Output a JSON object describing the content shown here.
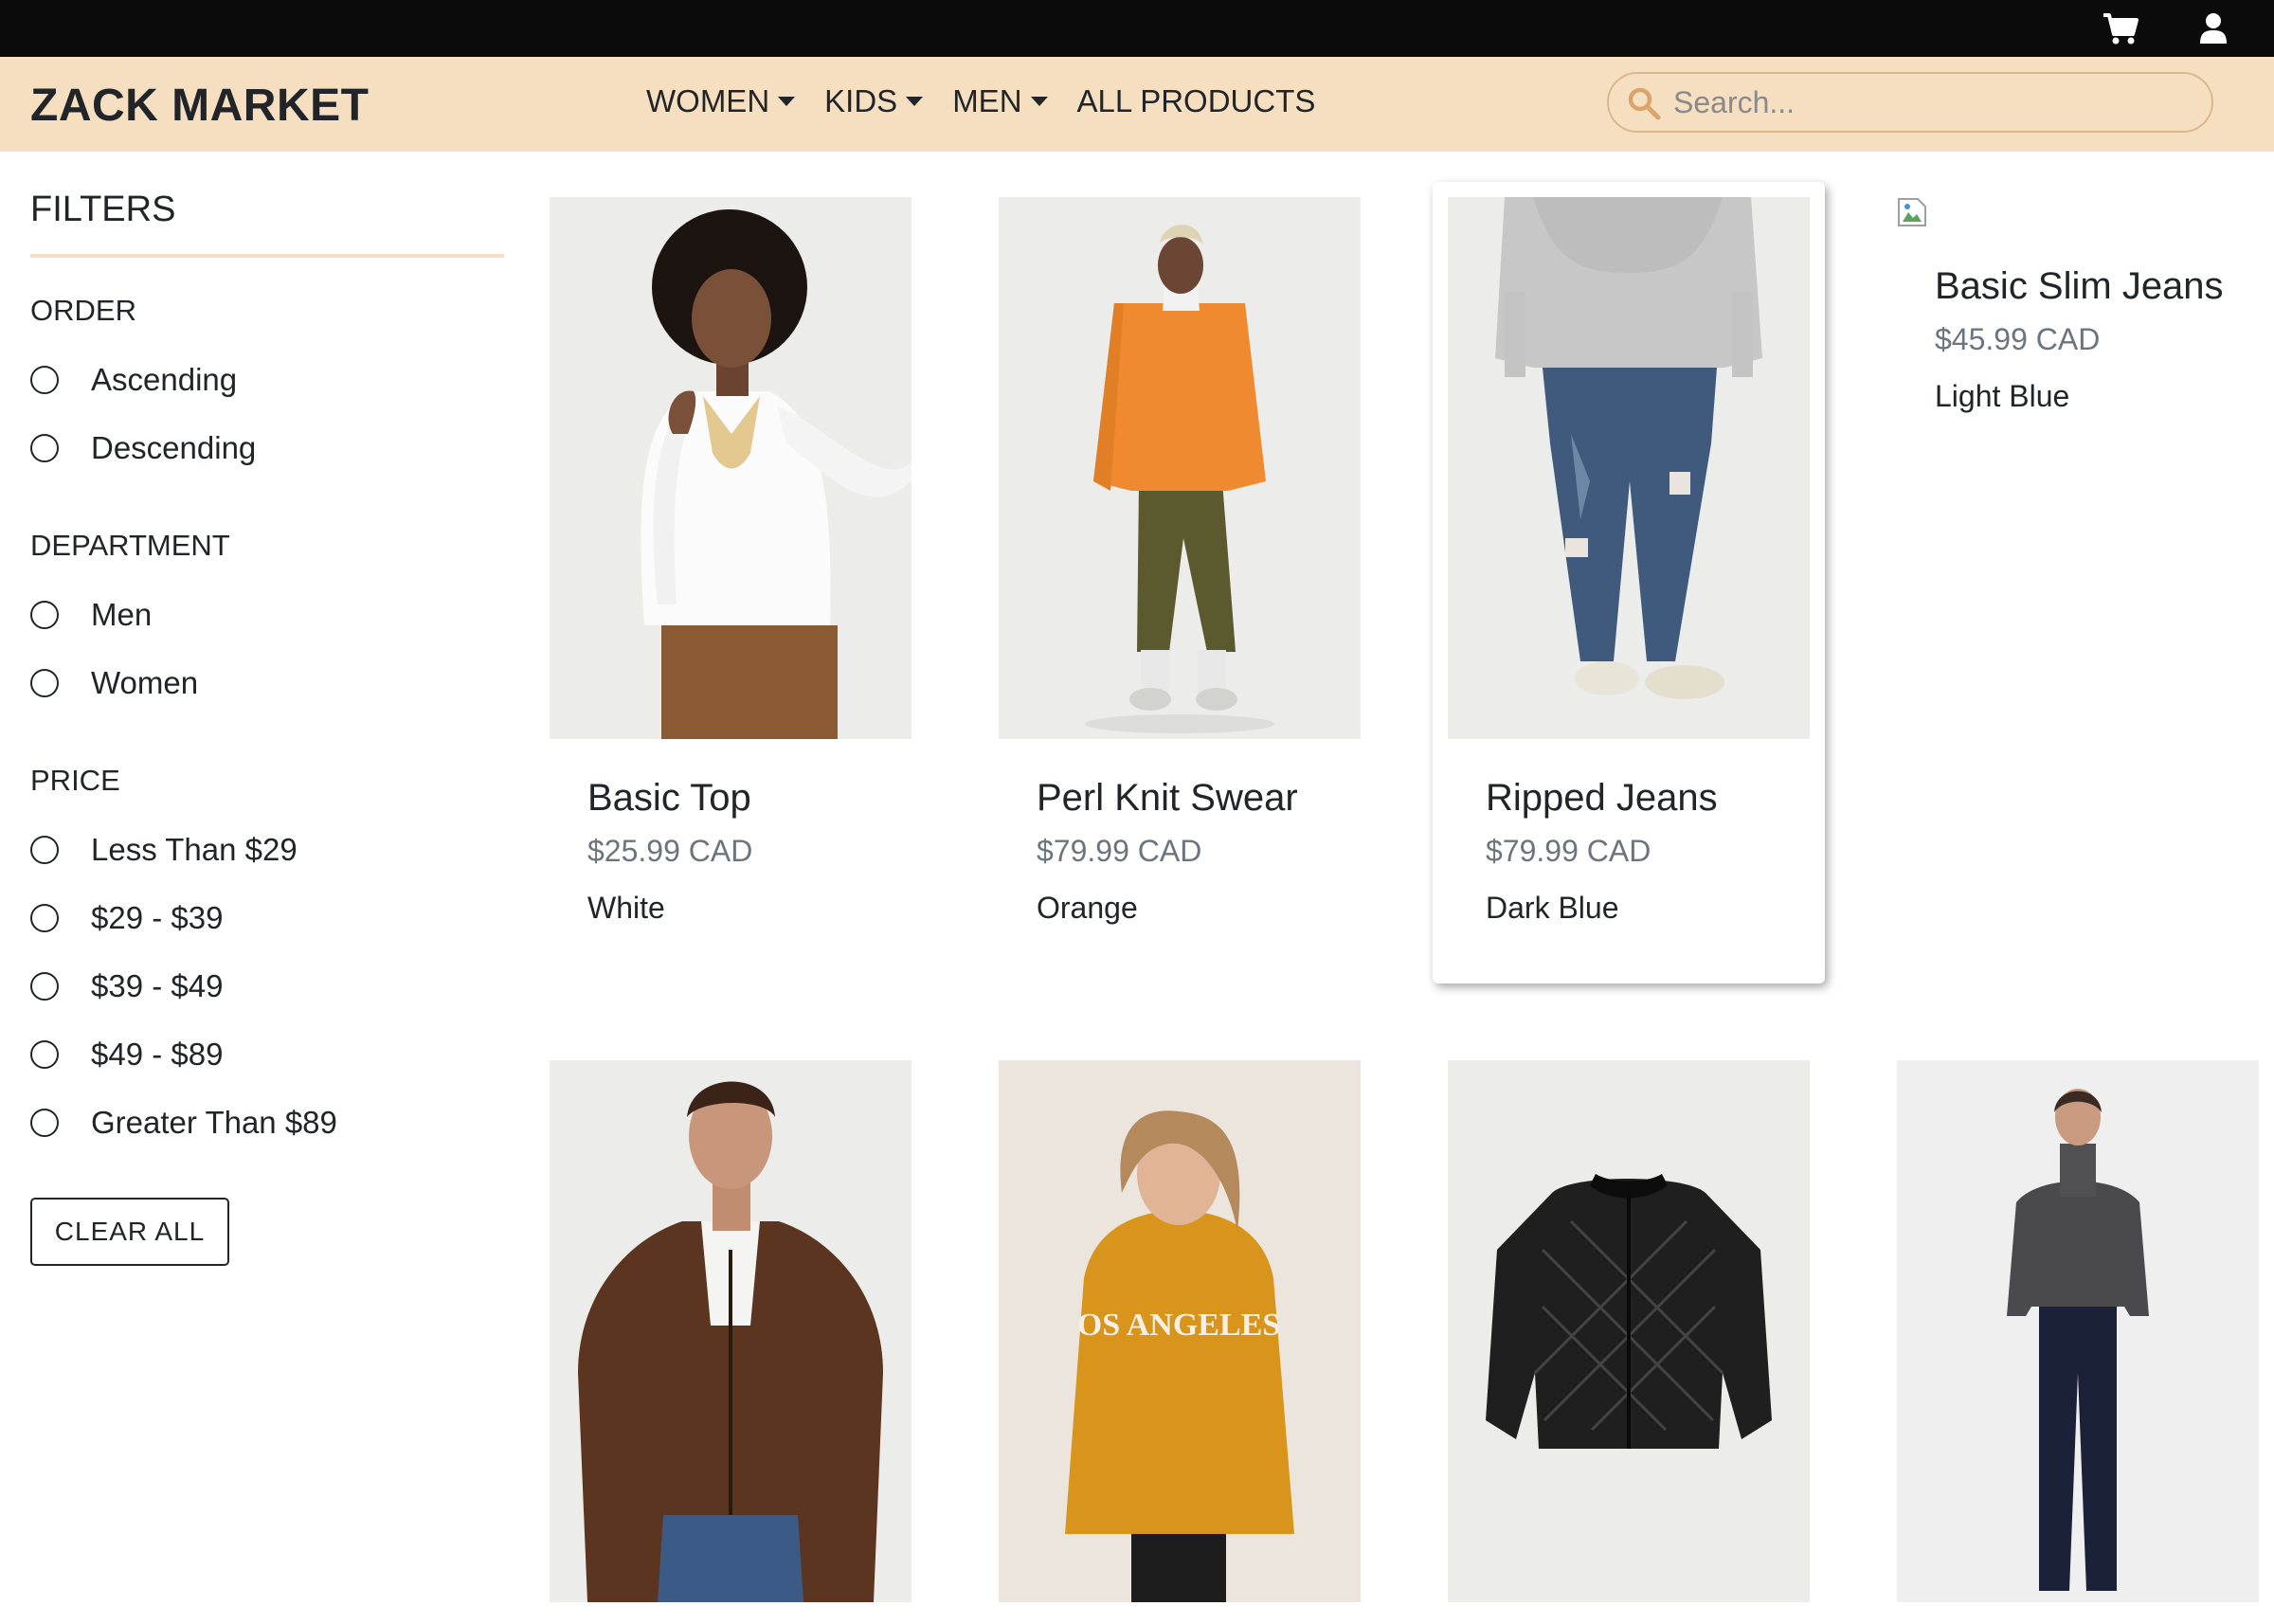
{
  "header": {
    "brand": "ZACK MARKET",
    "nav": [
      {
        "label": "WOMEN",
        "dropdown": true
      },
      {
        "label": "KIDS",
        "dropdown": true
      },
      {
        "label": "MEN",
        "dropdown": true
      },
      {
        "label": "ALL PRODUCTS",
        "dropdown": false
      }
    ],
    "search_placeholder": "Search...",
    "icons": [
      "cart-icon",
      "user-icon"
    ]
  },
  "filters": {
    "title": "FILTERS",
    "order": {
      "title": "ORDER",
      "options": [
        "Ascending",
        "Descending"
      ]
    },
    "department": {
      "title": "DEPARTMENT",
      "options": [
        "Men",
        "Women"
      ]
    },
    "price": {
      "title": "PRICE",
      "options": [
        "Less Than $29",
        "$29 - $39",
        "$39 - $49",
        "$49 - $89",
        "Greater Than $89"
      ]
    },
    "clear_label": "CLEAR ALL"
  },
  "products": [
    {
      "name": "Basic Top",
      "price": "$25.99 CAD",
      "color": "White"
    },
    {
      "name": "Perl Knit Swear",
      "price": "$79.99 CAD",
      "color": "Orange"
    },
    {
      "name": "Ripped Jeans",
      "price": "$79.99 CAD",
      "color": "Dark Blue"
    },
    {
      "name": "Basic Slim Jeans",
      "price": "$45.99 CAD",
      "color": "Light Blue"
    }
  ],
  "colors": {
    "navbar": "#f6dfc0",
    "topbar": "#0b0b0b",
    "accent": "#d9b88d",
    "price_text": "#6c757d"
  }
}
